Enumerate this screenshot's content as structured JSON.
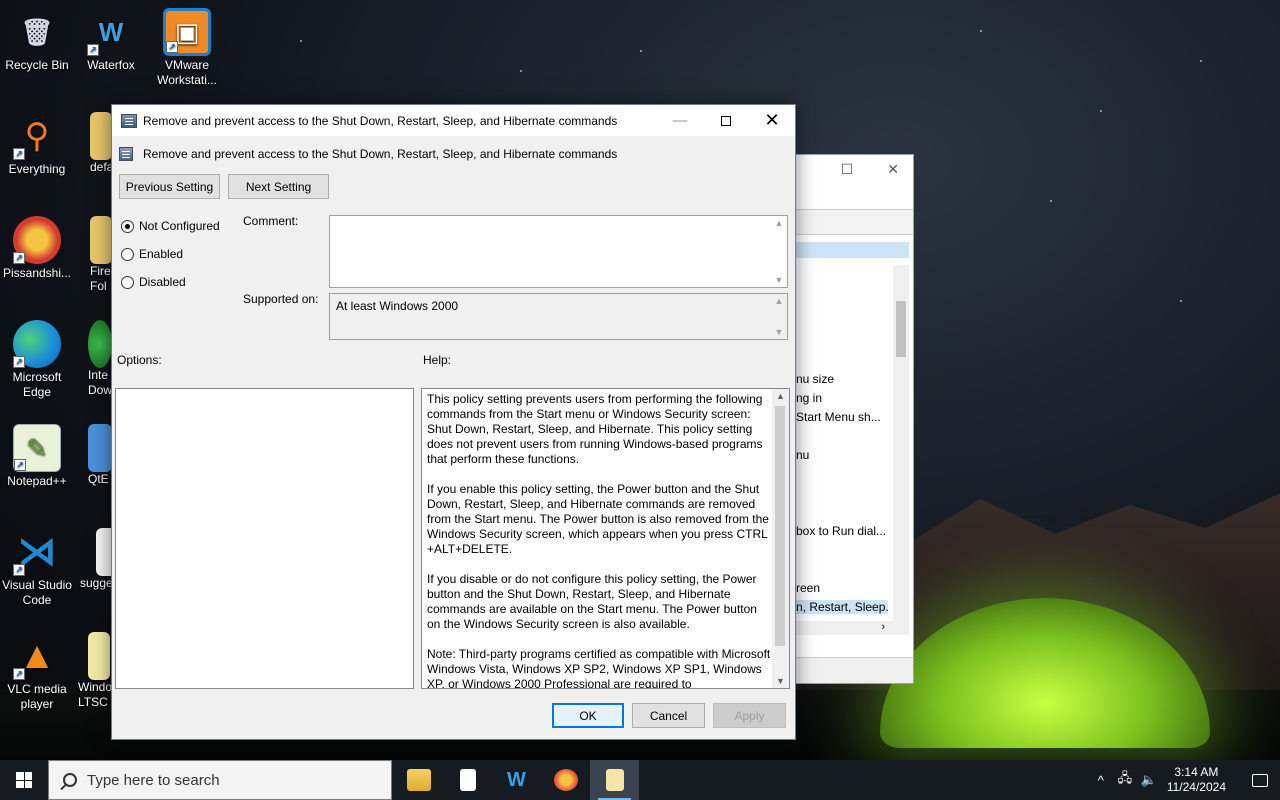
{
  "desktop": {
    "icons": [
      {
        "label": "Recycle Bin",
        "icon": "recycle-bin-icon"
      },
      {
        "label": "Waterfox",
        "icon": "waterfox-icon"
      },
      {
        "label": "VMware Workstati...",
        "icon": "vmware-icon"
      },
      {
        "label": "Everything",
        "icon": "everything-icon"
      },
      {
        "label": "defa",
        "icon": "folder-icon"
      },
      {
        "label": "Pissandshi...",
        "icon": "browser-icon"
      },
      {
        "label": "Fire Fol",
        "icon": "folder-icon"
      },
      {
        "label": "Microsoft Edge",
        "icon": "edge-icon"
      },
      {
        "label": "Inte Dow",
        "icon": "download-manager-icon"
      },
      {
        "label": "Notepad++",
        "icon": "notepadpp-icon"
      },
      {
        "label": "QtE",
        "icon": "monitor-icon"
      },
      {
        "label": "Visual Studio Code",
        "icon": "vscode-icon"
      },
      {
        "label": "sugge",
        "icon": "file-icon"
      },
      {
        "label": "VLC media player",
        "icon": "vlc-icon"
      },
      {
        "label": "Windo LTSC",
        "icon": "file-icon"
      }
    ]
  },
  "bg_window": {
    "items": [
      "nu size",
      "ng in",
      "Start Menu sh...",
      "nu",
      "box to Run dial...",
      "reen",
      "n, Restart, Sleep..."
    ]
  },
  "dialog": {
    "title": "Remove and prevent access to the Shut Down, Restart, Sleep, and Hibernate commands",
    "header": "Remove and prevent access to the Shut Down, Restart, Sleep, and Hibernate commands",
    "prev_button": "Previous Setting",
    "next_button": "Next Setting",
    "state_options": [
      {
        "label": "Not Configured",
        "selected": true
      },
      {
        "label": "Enabled",
        "selected": false
      },
      {
        "label": "Disabled",
        "selected": false
      }
    ],
    "comment_label": "Comment:",
    "comment_value": "",
    "supported_label": "Supported on:",
    "supported_value": "At least Windows 2000",
    "options_label": "Options:",
    "help_label": "Help:",
    "help_paragraphs": [
      "This policy setting prevents users from performing the following commands from the Start menu or Windows Security screen: Shut Down, Restart, Sleep, and Hibernate. This policy setting does not prevent users from running Windows-based programs that perform these functions.",
      "If you enable this policy setting, the Power button and the Shut Down, Restart, Sleep, and Hibernate commands are removed from the Start menu. The Power button is also removed from the Windows Security screen, which appears when you press CTRL +ALT+DELETE.",
      "If you disable or do not configure this policy setting, the Power button and the Shut Down, Restart, Sleep, and Hibernate commands are available on the Start menu. The Power button on the Windows Security screen is also available.",
      "Note: Third-party programs certified as compatible with Microsoft Windows Vista, Windows XP SP2, Windows XP SP1, Windows XP, or Windows 2000 Professional are required to"
    ],
    "ok_button": "OK",
    "cancel_button": "Cancel",
    "apply_button": "Apply"
  },
  "taskbar": {
    "search_placeholder": "Type here to search",
    "apps": [
      {
        "name": "file-explorer-icon",
        "color": "#f2c14e"
      },
      {
        "name": "notepad-icon",
        "color": "#ffffff"
      },
      {
        "name": "waterfox-icon",
        "color": "#3aa0e8"
      },
      {
        "name": "browser-icon",
        "color": "#e8563a"
      },
      {
        "name": "notepad-editor-icon",
        "color": "#f5e6a8"
      }
    ],
    "time": "3:14 AM",
    "date": "11/24/2024"
  }
}
